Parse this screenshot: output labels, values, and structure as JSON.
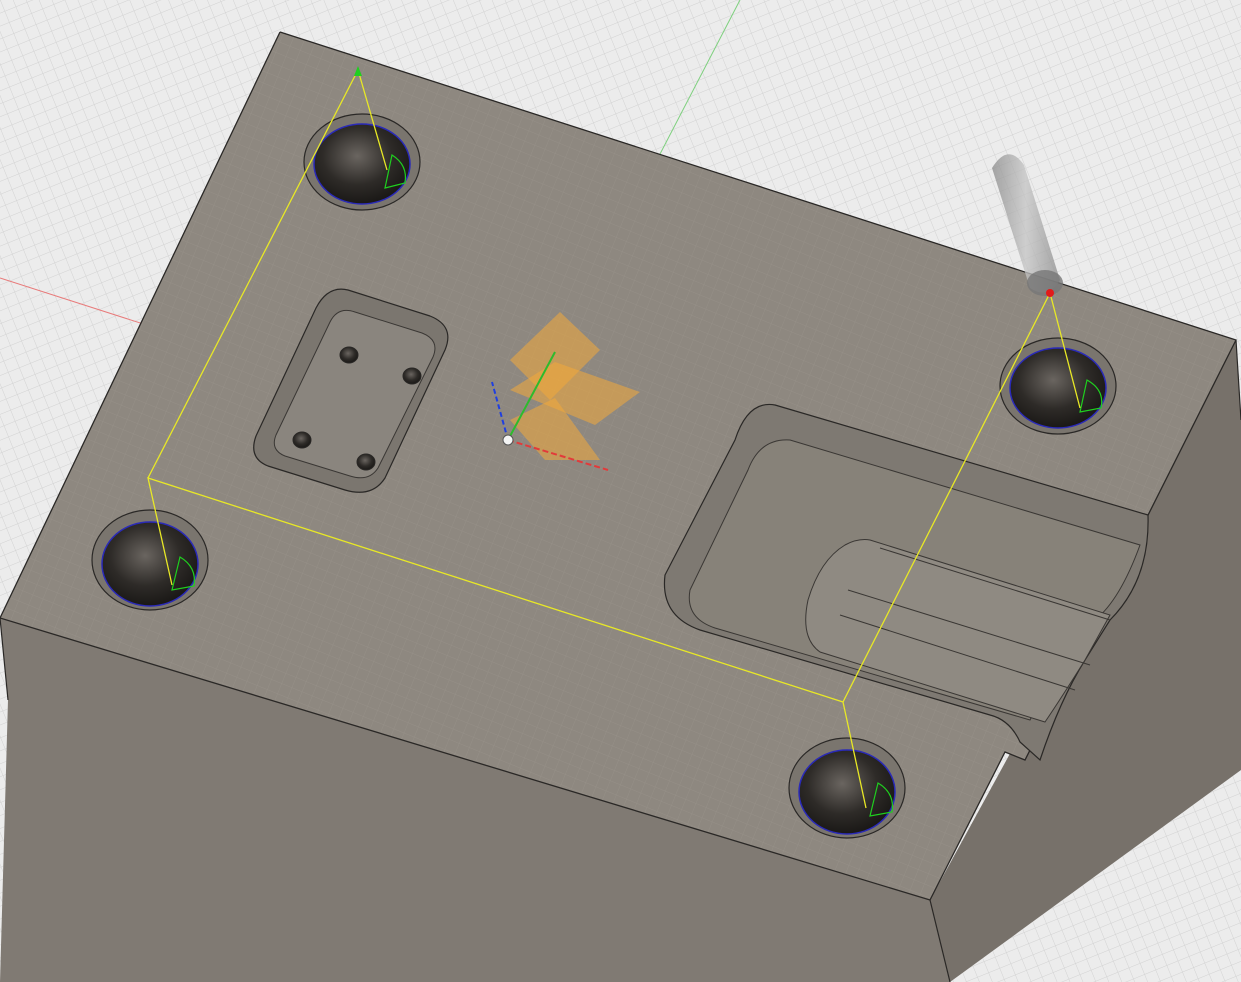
{
  "app": {
    "view": "3D CAM viewport"
  },
  "scene": {
    "background_color": "#ececec",
    "grid_color": "#d6d6d6",
    "stock_top_color": "#8e8880",
    "stock_side_left_color": "#6f6a64",
    "stock_side_front_color": "#807a73",
    "stock_side_right_color": "#77716a",
    "x_axis_color": "#e23a3a",
    "y_axis_color": "#2dbb2d",
    "z_axis_color": "#1f3fe0",
    "toolpath_color": "#e8e826",
    "hole_edge_color": "#2a2ab8",
    "arc_marker_color": "#1fcf1f",
    "wcs_plane_color": "#f2a93b",
    "tool_color": "#9a9a9a"
  },
  "features": {
    "holes": [
      "hole-1",
      "hole-2",
      "hole-3",
      "hole-4"
    ],
    "pockets": [
      "rect-pocket",
      "slot-pocket"
    ],
    "small_holes": [
      "small-hole-1",
      "small-hole-2",
      "small-hole-3",
      "small-hole-4"
    ]
  }
}
